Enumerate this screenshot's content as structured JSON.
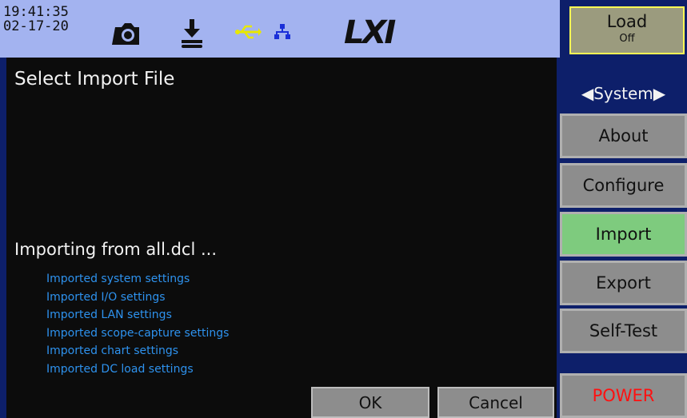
{
  "status": {
    "time": "19:41:35",
    "date": "02-17-20",
    "icons": [
      "camera-icon",
      "download-icon",
      "usb-icon",
      "lan-icon"
    ],
    "logo": "LXI"
  },
  "dialog": {
    "title": "Select Import File",
    "importing": "Importing from all.dcl ...",
    "log": [
      "Imported system settings",
      "Imported I/O settings",
      "Imported LAN settings",
      "Imported scope-capture settings",
      "Imported chart settings",
      "Imported DC load settings"
    ],
    "ok": "OK",
    "cancel": "Cancel"
  },
  "sidebar": {
    "load": "Load",
    "load_state": "Off",
    "menu": "◀System▶",
    "items": [
      "About",
      "Configure",
      "Import",
      "Export",
      "Self-Test"
    ],
    "power": "POWER"
  },
  "colors": {
    "accent_active": "#7ecb7e",
    "log_text": "#2e92ee",
    "power": "#ff1010",
    "load_border": "#ffff55"
  }
}
